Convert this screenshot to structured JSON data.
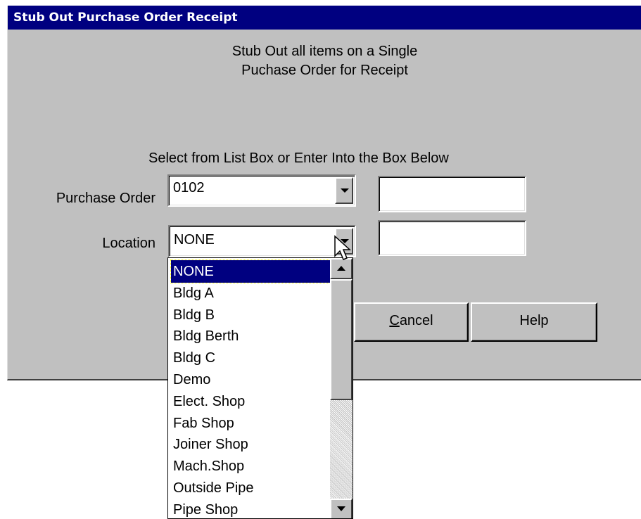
{
  "window": {
    "title": "Stub Out Purchase Order Receipt"
  },
  "instructions": {
    "line1": "Stub Out all items on a Single",
    "line2": "Puchase Order for Receipt",
    "select_hint": "Select from List Box or Enter Into the Box Below"
  },
  "purchase_order": {
    "label": "Purchase Order",
    "value": "0102",
    "entry_value": ""
  },
  "location": {
    "label": "Location",
    "value": "NONE",
    "entry_value": ""
  },
  "buttons": {
    "cancel_label": "Cancel",
    "cancel_mnemonic": "C",
    "help_label": "Help"
  },
  "location_dropdown": {
    "items": [
      "NONE",
      "Bldg A",
      "Bldg B",
      "Bldg Berth",
      "Bldg C",
      "Demo",
      "Elect. Shop",
      "Fab Shop",
      "Joiner Shop",
      "Mach.Shop",
      "Outside Pipe",
      "Pipe Shop"
    ],
    "selected_index": 0
  },
  "icons": {
    "cursor": "arrow-cursor-icon",
    "dropdown": "chevron-down-icon",
    "scroll_up": "scroll-up-arrow-icon",
    "scroll_down": "scroll-down-arrow-icon"
  },
  "colors": {
    "titlebar": "#000080",
    "dialog_bg": "#c0c0c0",
    "selection": "#000080"
  }
}
